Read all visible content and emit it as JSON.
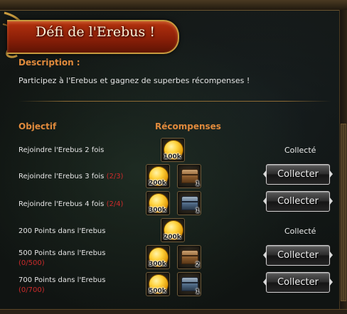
{
  "window": {
    "title": "Défi de l'Erebus !"
  },
  "description": {
    "heading": "Description :",
    "text": "Participez à l'Erebus et gagnez de superbes récompenses !"
  },
  "columns": {
    "objective": "Objectif",
    "rewards": "Récompenses"
  },
  "rows": [
    {
      "objective": "Rejoindre l'Erebus 2 fois",
      "progress": "",
      "rewards": [
        {
          "icon": "gold-coin-icon",
          "label": "100k"
        }
      ],
      "status": "Collecté"
    },
    {
      "objective": "Rejoindre l'Erebus 3 fois",
      "progress": "(2/3)",
      "rewards": [
        {
          "icon": "gold-coin-icon",
          "label": "200k"
        },
        {
          "icon": "wooden-chest-icon",
          "label": "1"
        }
      ],
      "button": "Collecter"
    },
    {
      "objective": "Rejoindre l'Erebus 4 fois",
      "progress": "(2/4)",
      "rewards": [
        {
          "icon": "gold-coin-icon",
          "label": "300k"
        },
        {
          "icon": "steel-chest-icon",
          "label": "1"
        }
      ],
      "button": "Collecter"
    },
    {
      "objective": "200 Points dans l'Erebus",
      "progress": "",
      "rewards": [
        {
          "icon": "gold-coin-icon",
          "label": "200k"
        }
      ],
      "status": "Collecté"
    },
    {
      "objective": "500 Points dans l'Erebus",
      "progress": "(0/500)",
      "rewards": [
        {
          "icon": "gold-coin-icon",
          "label": "300k"
        },
        {
          "icon": "wooden-chest-icon",
          "label": "2"
        }
      ],
      "button": "Collecter"
    },
    {
      "objective": "700 Points dans l'Erebus",
      "progress": "(0/700)",
      "rewards": [
        {
          "icon": "gold-coin-icon",
          "label": "500k"
        },
        {
          "icon": "steel-chest-icon",
          "label": "1"
        }
      ],
      "button": "Collecter"
    }
  ],
  "colors": {
    "heading_orange": "#e08a3c",
    "progress_red": "#cc2b2b",
    "banner_red": "#a8280a"
  }
}
